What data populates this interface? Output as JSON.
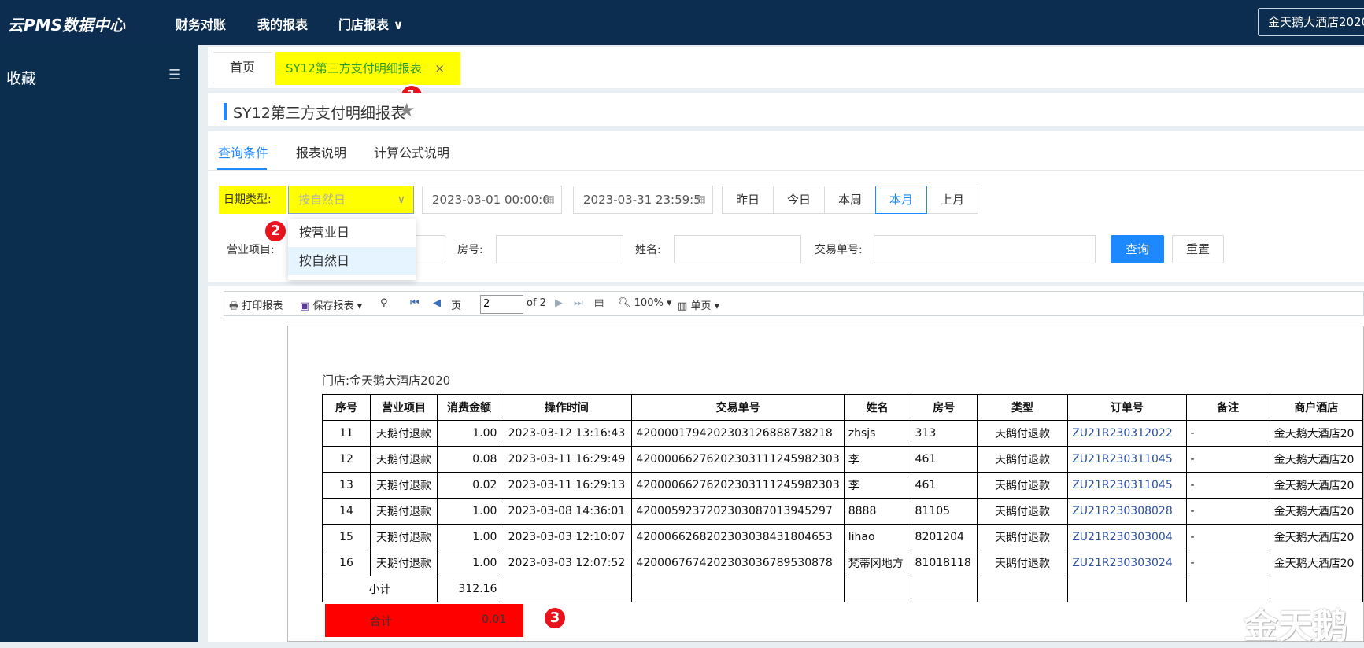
{
  "app": {
    "title": "云PMS数据中心"
  },
  "topnav": {
    "items": [
      "财务对账",
      "我的报表",
      "门店报表"
    ],
    "chevron": "chevron-down-icon",
    "store": "金天鹅大酒店2020"
  },
  "sidebar": {
    "title": "收藏",
    "collapse_icon": "menu-collapse-icon"
  },
  "tabs": {
    "home": "首页",
    "active": "SY12第三方支付明细报表",
    "close": "×"
  },
  "page": {
    "title": "SY12第三方支付明细报表"
  },
  "badges": [
    "1",
    "2",
    "3"
  ],
  "query_tabs": [
    "查询条件",
    "报表说明",
    "计算公式说明"
  ],
  "filters": {
    "date_type_label": "日期类型:",
    "date_type_value": "按自然日",
    "start": "2023-03-01 00:00:0",
    "end": "2023-03-31 23:59:5",
    "quick": [
      "昨日",
      "今日",
      "本周",
      "本月",
      "上月"
    ],
    "item_label": "营业项目:",
    "room_label": "房号:",
    "name_label": "姓名:",
    "txn_label": "交易单号:",
    "search": "查询",
    "reset": "重置"
  },
  "dropdown": {
    "options": [
      "按营业日",
      "按自然日"
    ],
    "selected": "按自然日"
  },
  "toolbar": {
    "print": "打印报表",
    "save": "保存报表",
    "page_label": "页",
    "page": "2",
    "of": "of 2",
    "zoom": "100%",
    "view": "单页"
  },
  "report": {
    "store": "门店:金天鹅大酒店2020",
    "headers": [
      "序号",
      "营业项目",
      "消费金额",
      "操作时间",
      "交易单号",
      "姓名",
      "房号",
      "类型",
      "订单号",
      "备注",
      "商户酒店"
    ],
    "rows": [
      [
        "11",
        "天鹅付退款",
        "1.00",
        "2023-03-12 13:16:43",
        "420000179420230312688873821​8",
        "zhsjs",
        "313",
        "天鹅付退款",
        "ZU21R230312022",
        "-",
        "金天鹅大酒店20"
      ],
      [
        "12",
        "天鹅付退款",
        "0.08",
        "2023-03-11 16:29:49",
        "4200006627620230311124598230​3",
        "李",
        "461",
        "天鹅付退款",
        "ZU21R230311045",
        "-",
        "金天鹅大酒店20"
      ],
      [
        "13",
        "天鹅付退款",
        "0.02",
        "2023-03-11 16:29:13",
        "4200006627620230311124598230​3",
        "李",
        "461",
        "天鹅付退款",
        "ZU21R230311045",
        "-",
        "金天鹅大酒店20"
      ],
      [
        "14",
        "天鹅付退款",
        "1.00",
        "2023-03-08 14:36:01",
        "4200059237202303087013945297",
        "8888",
        "81105",
        "天鹅付退款",
        "ZU21R230308028",
        "-",
        "金天鹅大酒店20"
      ],
      [
        "15",
        "天鹅付退款",
        "1.00",
        "2023-03-03 12:10:07",
        "4200066268202303038431804653",
        "lihao",
        "8201204",
        "天鹅付退款",
        "ZU21R230303004",
        "-",
        "金天鹅大酒店20"
      ],
      [
        "16",
        "天鹅付退款",
        "1.00",
        "2023-03-03 12:07:52",
        "4200067674202303036789530878",
        "梵蒂冈地方",
        "81018118",
        "天鹅付退款",
        "ZU21R230303024",
        "-",
        "金天鹅大酒店20"
      ]
    ],
    "subtotal_label": "小计",
    "subtotal_value": "312.16",
    "total_label": "合计",
    "total_value": "0.01"
  },
  "watermark": "金天鹅"
}
